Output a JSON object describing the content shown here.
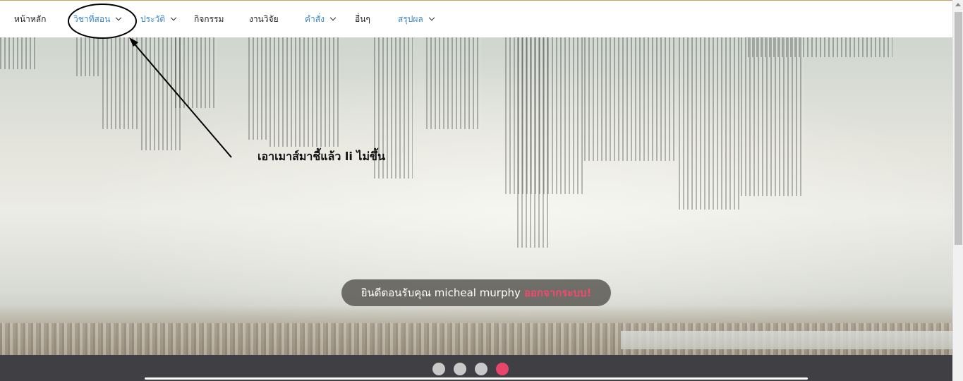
{
  "nav": {
    "items": [
      {
        "label": "หน้าหลัก",
        "dropdown": false,
        "color": "#222222"
      },
      {
        "label": "วิชาที่สอน",
        "dropdown": true,
        "color": "#3a87c8"
      },
      {
        "label": "ประวัติ",
        "dropdown": true,
        "color": "#3a87c8"
      },
      {
        "label": "กิจกรรม",
        "dropdown": false,
        "color": "#222222"
      },
      {
        "label": "งานวิจัย",
        "dropdown": false,
        "color": "#222222"
      },
      {
        "label": "คำสั่ง",
        "dropdown": true,
        "color": "#3a87c8"
      },
      {
        "label": "อื่นๆ",
        "dropdown": false,
        "color": "#222222"
      },
      {
        "label": "สรุปผล",
        "dropdown": true,
        "color": "#3a87c8"
      }
    ]
  },
  "annotation": {
    "text": "เอาเมาส์มาชี้แล้ว li ไม่ขึ้น"
  },
  "welcome": {
    "greeting": "ยินดีตอนรับคุณ micheal murphy",
    "logout": "ออกจากระบบ!",
    "logout_color": "#f04a6d"
  },
  "slider": {
    "dot_count": 4,
    "active_index": 4,
    "active_color": "#e8456a"
  }
}
